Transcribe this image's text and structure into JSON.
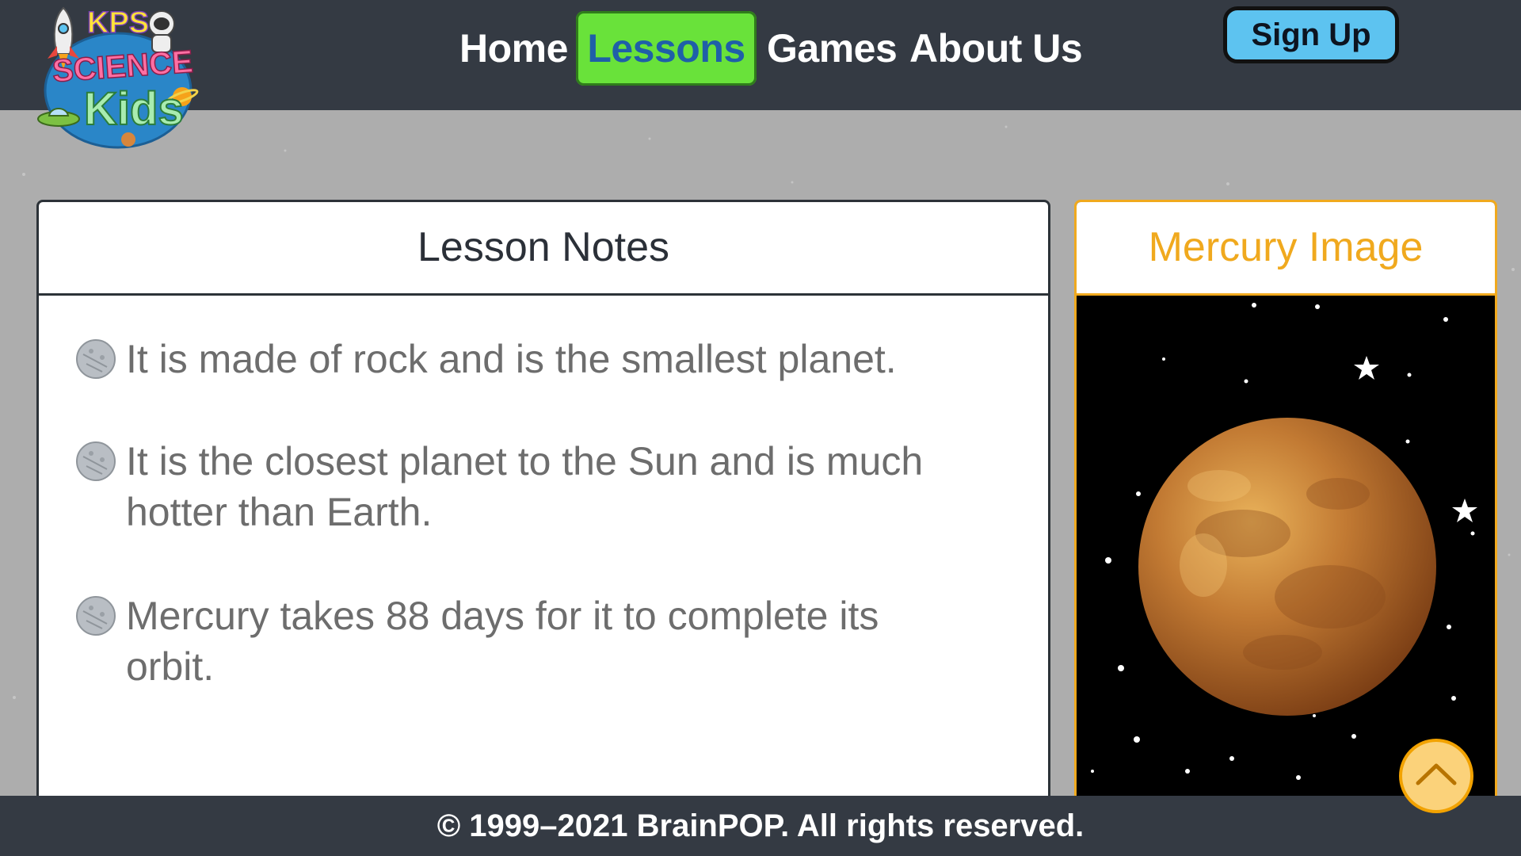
{
  "header": {
    "logo": {
      "line1": "KPS",
      "line2": "SCIENCE",
      "line3": "Kids"
    },
    "nav": [
      {
        "label": "Home",
        "active": false
      },
      {
        "label": "Lessons",
        "active": true
      },
      {
        "label": "Games",
        "active": false
      },
      {
        "label": "About Us",
        "active": false
      }
    ],
    "signup_label": "Sign Up"
  },
  "lesson_notes": {
    "title": "Lesson Notes",
    "items": [
      "It is made of rock and is the smallest planet.",
      "It is the closest planet to the Sun and is much hotter than Earth.",
      "Mercury takes 88 days for it to complete its orbit."
    ],
    "bullet_icon": "moon-icon"
  },
  "image_card": {
    "title": "Mercury Image",
    "image_icon": "mercury-planet-icon"
  },
  "footer": {
    "copyright": "© 1999–2021 BrainPOP. All rights reserved."
  },
  "back_to_top_icon": "chevron-up-icon",
  "colors": {
    "header_bg": "#343a43",
    "active_nav_bg": "#69e23a",
    "active_nav_text": "#1f5fa8",
    "signup_bg": "#5dc3f0",
    "accent_orange": "#f0a91e",
    "page_bg": "#adadad"
  }
}
